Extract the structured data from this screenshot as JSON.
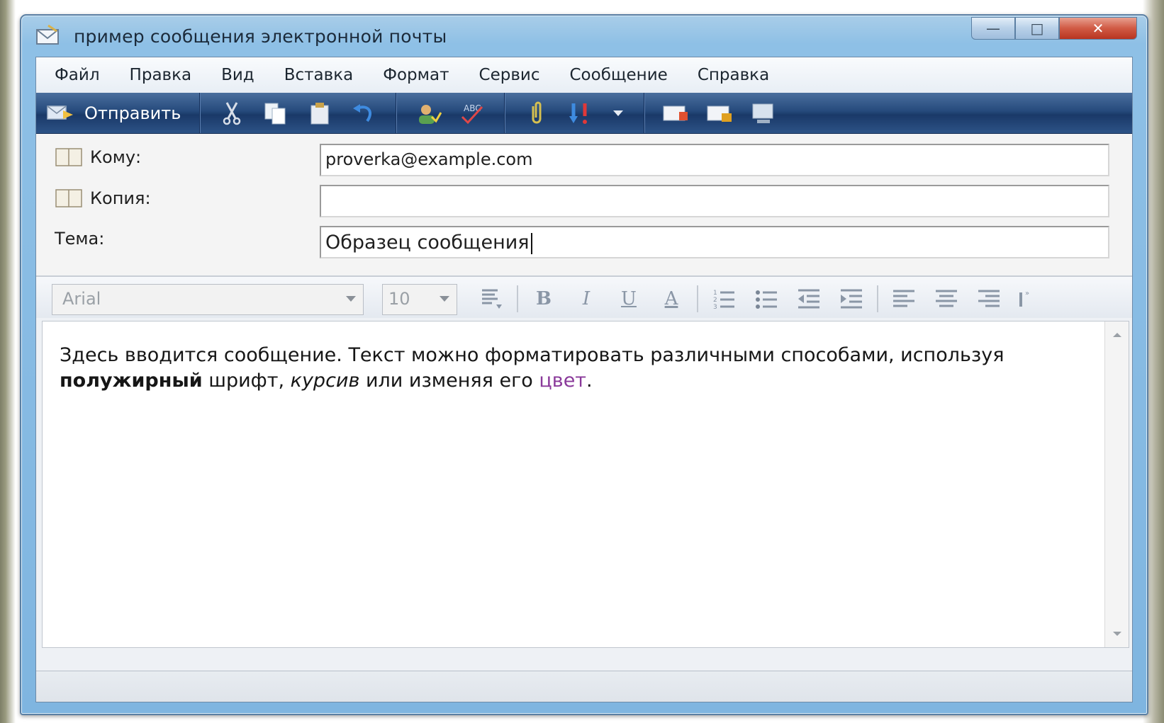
{
  "window": {
    "title": "пример сообщения электронной почты",
    "controls": {
      "minimize": "—",
      "maximize": "□",
      "close": "✕"
    }
  },
  "menu": {
    "items": [
      "Файл",
      "Правка",
      "Вид",
      "Вставка",
      "Формат",
      "Сервис",
      "Сообщение",
      "Справка"
    ]
  },
  "toolbar": {
    "send_label": "Отправить",
    "icons": [
      "cut-icon",
      "copy-icon",
      "paste-icon",
      "undo-icon",
      "check-names-icon",
      "spelling-icon",
      "attach-icon",
      "priority-icon",
      "dropdown-icon",
      "sign-icon",
      "encrypt-icon",
      "offline-icon"
    ]
  },
  "headers": {
    "to_label": "Кому:",
    "to_value": "proverka@example.com",
    "cc_label": "Копия:",
    "cc_value": "",
    "subject_label": "Тема:",
    "subject_value": "Образец сообщения"
  },
  "format_bar": {
    "font": "Arial",
    "size": "10",
    "bold": "B",
    "italic": "I",
    "underline": "U",
    "font_color": "A"
  },
  "message": {
    "part1": "Здесь вводится сообщение. Текст можно форматировать различными способами, используя ",
    "bold": "полужирный",
    "part2": " шрифт, ",
    "italic": "курсив",
    "part3": " или изменяя его ",
    "colored": "цвет",
    "part4": ".",
    "colored_hex": "#8a3a9a"
  }
}
